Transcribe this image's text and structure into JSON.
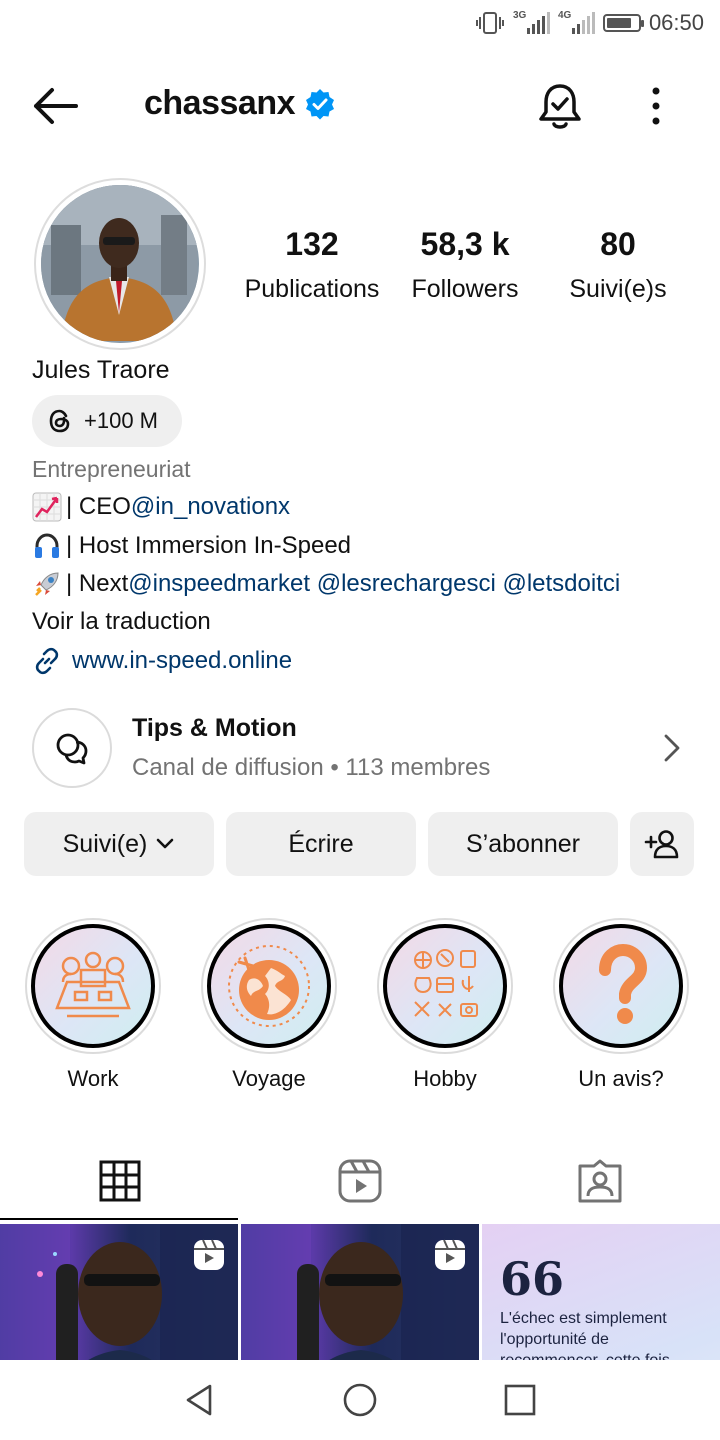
{
  "status_bar": {
    "time": "06:50",
    "network_1": "3G",
    "network_2": "4G",
    "icons": [
      "vibrate-icon",
      "signal-icon",
      "battery-icon"
    ]
  },
  "header": {
    "username": "chassanx",
    "verified": true,
    "icons": [
      "back-arrow-icon",
      "verified-badge-icon",
      "notification-bell-icon",
      "more-vertical-icon"
    ]
  },
  "profile": {
    "stats": [
      {
        "value": "132",
        "label": "Publications"
      },
      {
        "value": "58,3 k",
        "label": "Followers"
      },
      {
        "value": "80",
        "label": "Suivi(e)s"
      }
    ],
    "full_name": "Jules Traore",
    "threads_badge": "+100 M",
    "category": "Entrepreneuriat",
    "bio": {
      "line1_text": "| CEO ",
      "line1_mention": "@in_novationx",
      "line2_text": "| Host Immersion In-Speed",
      "line3_text": "| Next ",
      "line3_mentions": "@inspeedmarket @lesrechargesci @letsdoitci"
    },
    "translate_label": "Voir la traduction",
    "website": "www.in-speed.online"
  },
  "channel": {
    "title": "Tips & Motion",
    "subtitle": "Canal de diffusion • 113 membres"
  },
  "actions": {
    "following_label": "Suivi(e)",
    "message_label": "Écrire",
    "subscribe_label": "S’abonner"
  },
  "highlights": [
    {
      "label": "Work"
    },
    {
      "label": "Voyage"
    },
    {
      "label": "Hobby"
    },
    {
      "label": "Un avis?"
    }
  ],
  "tabs": [
    "grid-icon",
    "reels-icon",
    "tagged-icon"
  ],
  "posts": {
    "quote_mark": "66",
    "quote_text": "L'échec est simplement l'opportunité de recommencer, cette fois"
  },
  "colors": {
    "link": "#00376b",
    "verified": "#0095f6",
    "secondary_text": "#737373",
    "button_bg": "#efefef",
    "highlight_accent": "#f08a4b"
  }
}
